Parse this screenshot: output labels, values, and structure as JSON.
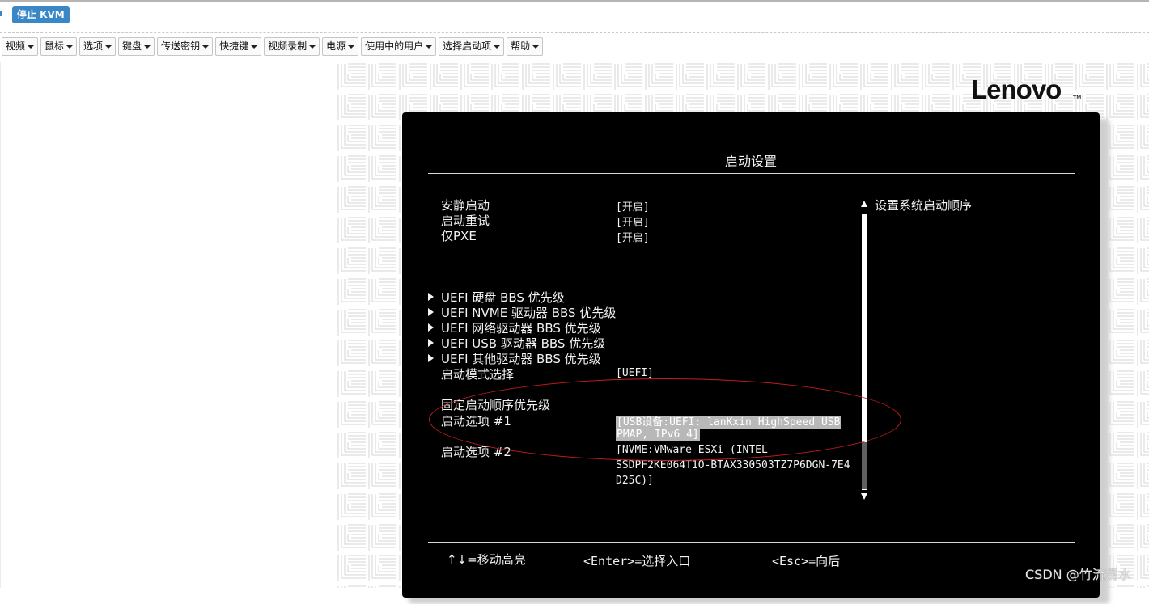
{
  "toolbar": {
    "stop_button": "停止 KVM"
  },
  "menu": [
    "视频",
    "鼠标",
    "选项",
    "键盘",
    "传送密钥",
    "快捷键",
    "视频录制",
    "电源",
    "使用中的用户",
    "选择启动项",
    "帮助"
  ],
  "brand": {
    "logo": "Lenovo",
    "trademark": "TM"
  },
  "bios": {
    "title": "启动设置",
    "settings": [
      {
        "label": "安静启动",
        "value": "[开启]"
      },
      {
        "label": "启动重试",
        "value": "[开启]"
      },
      {
        "label": "仅PXE",
        "value": "[开启]"
      }
    ],
    "submenus": [
      "UEFI 硬盘 BBS 优先级",
      "UEFI NVME 驱动器 BBS 优先级",
      "UEFI 网络驱动器 BBS 优先级",
      "UEFI USB 驱动器 BBS 优先级",
      "UEFI 其他驱动器 BBS 优先级"
    ],
    "boot_mode": {
      "label": "启动模式选择",
      "value": "[UEFI]"
    },
    "fixed_order_title": "固定启动顺序优先级",
    "boot_option_1": {
      "label": "启动选项 #1",
      "value_line1": "[USB设备:UEFI: lanKxin HighSpeed USB",
      "value_line2": "PMAP, IPv6  4]"
    },
    "boot_option_2": {
      "label": "启动选项 #2",
      "value_line1": "[NVME:VMware ESXi (INTEL",
      "value_line2": "SSDPF2KE064T1O-BTAX330503TZ7P6DGN-7E4",
      "value_line3": "D25C)]"
    },
    "help_text": "设置系统启动顺序",
    "footer": {
      "move": "↑↓=移动高亮",
      "enter": "<Enter>=选择入口",
      "esc": "<Esc>=向后"
    }
  },
  "watermark": "CSDN @竹流清水"
}
